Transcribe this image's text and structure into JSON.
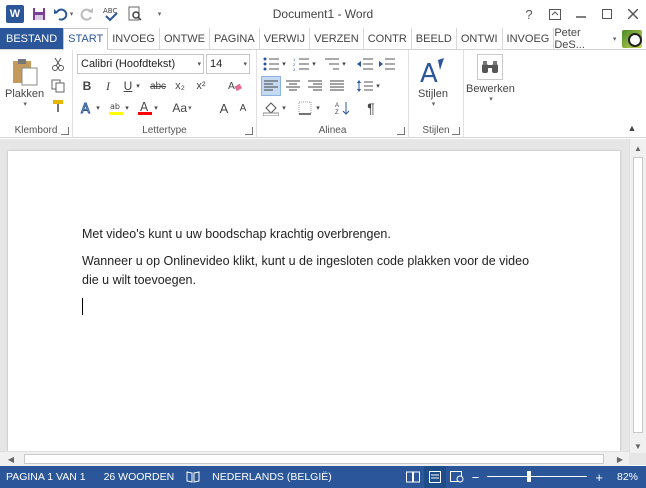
{
  "window": {
    "title": "Document1 - Word",
    "help": "?"
  },
  "tabs": [
    {
      "label": "BESTAND"
    },
    {
      "label": "START"
    },
    {
      "label": "INVOEG"
    },
    {
      "label": "ONTWE"
    },
    {
      "label": "PAGINA"
    },
    {
      "label": "VERWIJ"
    },
    {
      "label": "VERZEN"
    },
    {
      "label": "CONTR"
    },
    {
      "label": "BEELD"
    },
    {
      "label": "ONTWI"
    },
    {
      "label": "INVOEG"
    }
  ],
  "user": {
    "name": "Peter DeS..."
  },
  "ribbon": {
    "clipboard": {
      "paste_label": "Plakken",
      "group_label": "Klembord"
    },
    "font": {
      "font_name": "Calibri (Hoofdtekst)",
      "font_size": "14",
      "bold": "B",
      "italic": "I",
      "underline": "U",
      "strikethrough": "abc",
      "subscript": "x₂",
      "superscript": "x²",
      "case": "Aa",
      "grow": "A",
      "shrink": "A",
      "group_label": "Lettertype"
    },
    "paragraph": {
      "group_label": "Alinea",
      "pilcrow": "¶"
    },
    "styles": {
      "label": "Stijlen",
      "group_label": "Stijlen"
    },
    "editing": {
      "label": "Bewerken"
    }
  },
  "document": {
    "paragraphs": [
      "Met video's kunt u uw boodschap krachtig overbrengen.",
      "Wanneer u op Onlinevideo klikt, kunt u de ingesloten code plakken voor de video die u wilt toevoegen."
    ]
  },
  "statusbar": {
    "page": "PAGINA 1 VAN 1",
    "words": "26 WOORDEN",
    "language": "NEDERLANDS (BELGIË)",
    "zoom_out": "−",
    "zoom_in": "+",
    "zoom": "82%",
    "zoom_fraction": 0.41
  },
  "colors": {
    "accent": "#2b579a",
    "highlight": "#ffff00",
    "font_color": "#ff0000"
  }
}
